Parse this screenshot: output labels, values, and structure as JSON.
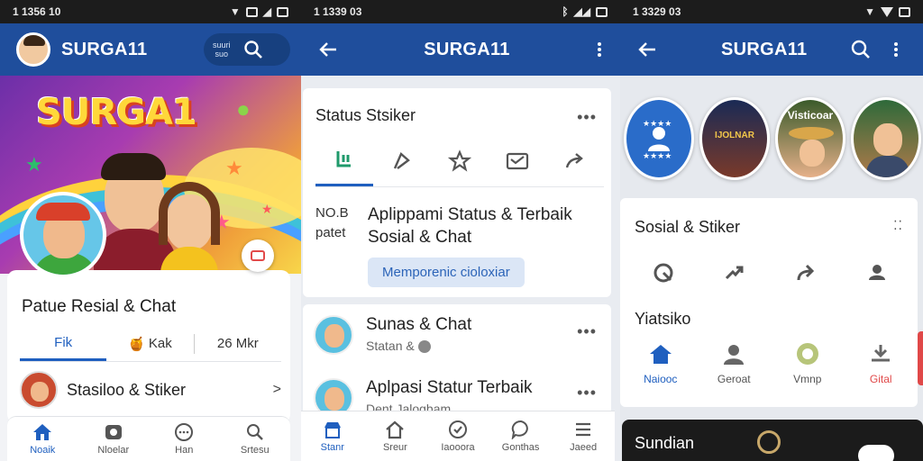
{
  "screen1": {
    "status": {
      "time": "1 1356 10"
    },
    "header": {
      "title": "SURGA11",
      "search_hint": "suuri\nsuo"
    },
    "hero": {
      "logo": "SURGA1"
    },
    "profile": {
      "name": "Patue Resial & Chat"
    },
    "tabs": [
      {
        "label": "Fik",
        "icon": ""
      },
      {
        "label": "Kak",
        "icon": "🍯"
      },
      {
        "label": "26 Mkr",
        "icon": ""
      }
    ],
    "row": {
      "label": "Stasiloo & Stiker",
      "chevron": "˃"
    },
    "nav": [
      {
        "label": "Noaik",
        "icon": "home-icon"
      },
      {
        "label": "Nloelar",
        "icon": "sticker-icon"
      },
      {
        "label": "Han",
        "icon": "chat-icon"
      },
      {
        "label": "Srtesu",
        "icon": "search-person-icon"
      }
    ]
  },
  "screen2": {
    "status": {
      "time": "1 1339 03"
    },
    "header": {
      "title": "SURGA11"
    },
    "card": {
      "heading": "Status Stsiker",
      "more": "•••",
      "side_top": "NO.B",
      "side_bottom": "patet",
      "line1": "Aplippami Status & Terbaik",
      "line2": "Sosial & Chat",
      "chip": "Memporenic cioloxiar"
    },
    "list": [
      {
        "title": "Sunas & Chat",
        "sub": "Statan &",
        "more": "•••"
      },
      {
        "title": "Aplpasi Statur Terbaik",
        "sub": "Dent Jalogbam",
        "more": "•••"
      }
    ],
    "nav": [
      {
        "label": "Stanr",
        "icon": "store-icon"
      },
      {
        "label": "Sreur",
        "icon": "home-icon"
      },
      {
        "label": "Iaooora",
        "icon": "check-circle-icon"
      },
      {
        "label": "Gonthas",
        "icon": "chat-icon"
      },
      {
        "label": "Jaeed",
        "icon": "menu-icon"
      }
    ]
  },
  "screen3": {
    "status": {
      "time": "1 3329 03"
    },
    "header": {
      "title": "SURGA11"
    },
    "stories": [
      {
        "caption": ""
      },
      {
        "caption": "IJOLNAR"
      },
      {
        "caption": "Visticoar"
      },
      {
        "caption": ""
      }
    ],
    "card": {
      "heading": "Sosial & Stiker",
      "more": "⁚⁚"
    },
    "section": "Yiatsiko",
    "grid": [
      {
        "label": "Naiooc",
        "icon": "home-icon"
      },
      {
        "label": "Geroat",
        "icon": "person-icon"
      },
      {
        "label": "Vmnp",
        "icon": "badge-icon"
      },
      {
        "label": "Gital",
        "icon": "download-icon"
      }
    ],
    "promo": {
      "title": "Sundian"
    }
  },
  "colors": {
    "appbar": "#1f4e9c",
    "accent": "#1f5fbf",
    "statusbar": "#1c1c1c"
  }
}
